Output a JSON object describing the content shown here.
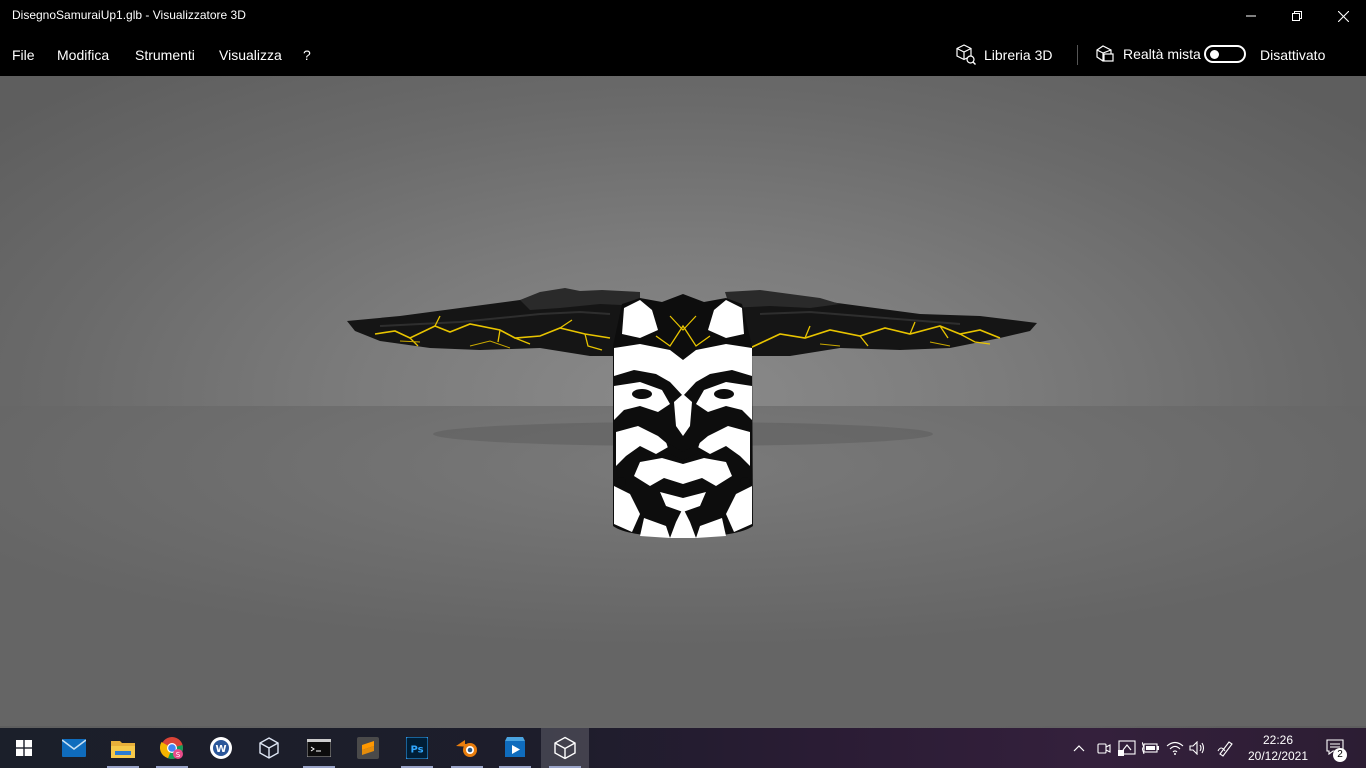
{
  "window": {
    "title": "DisegnoSamuraiUp1.glb - Visualizzatore 3D"
  },
  "menu": {
    "file": "File",
    "edit": "Modifica",
    "tools": "Strumenti",
    "view": "Visualizza",
    "help": "?"
  },
  "toolbar": {
    "library_label": "Libreria 3D",
    "library_icon": "cube-library-icon",
    "mixed_reality_label": "Realtà mista",
    "mixed_reality_icon": "mixed-reality-icon",
    "mixed_reality_state": "Disattivato",
    "mixed_reality_on": false
  },
  "taskbar": {
    "apps": [
      {
        "name": "start",
        "icon": "windows-logo-icon"
      },
      {
        "name": "mail",
        "icon": "mail-icon"
      },
      {
        "name": "file-explorer",
        "icon": "folder-icon"
      },
      {
        "name": "chrome",
        "icon": "chrome-icon"
      },
      {
        "name": "word",
        "icon": "word-icon"
      },
      {
        "name": "virtualbox",
        "icon": "cube-wireframe-icon"
      },
      {
        "name": "terminal",
        "icon": "terminal-icon"
      },
      {
        "name": "sublime-text",
        "icon": "sublime-icon"
      },
      {
        "name": "photoshop",
        "icon": "photoshop-icon",
        "label": "Ps"
      },
      {
        "name": "blender",
        "icon": "blender-icon"
      },
      {
        "name": "movies",
        "icon": "play-icon"
      },
      {
        "name": "3d-viewer",
        "icon": "3d-viewer-icon",
        "active": true
      }
    ],
    "clock": {
      "time": "22:26",
      "date": "20/12/2021"
    },
    "notifications_count": "2"
  },
  "colors": {
    "accent_yellow": "#e8c400",
    "taskbar_active": "#9aa4c8"
  }
}
